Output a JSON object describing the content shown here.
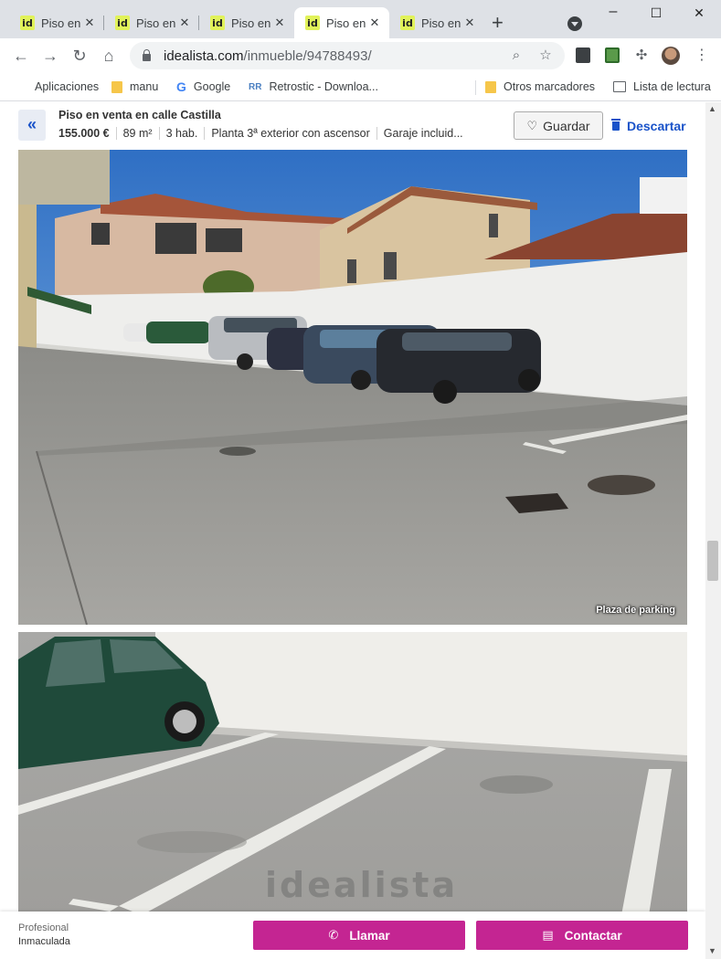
{
  "browser": {
    "tabs": [
      {
        "title": "Piso en venta en calle Castilla",
        "favicon": "id",
        "active": false
      },
      {
        "title": "Piso en venta en calle Castilla",
        "favicon": "id",
        "active": false
      },
      {
        "title": "Piso en venta en calle Castilla",
        "favicon": "id",
        "active": false
      },
      {
        "title": "Piso en venta en calle Castilla",
        "favicon": "id",
        "active": true
      },
      {
        "title": "Piso en venta en calle Castilla",
        "favicon": "id",
        "active": false
      }
    ],
    "url_host": "idealista.com",
    "url_path": "/inmueble/94788493/",
    "bookmarks": [
      {
        "label": "Aplicaciones",
        "icon": "apps-grid-icon"
      },
      {
        "label": "manu",
        "icon": "folder-icon"
      },
      {
        "label": "Google",
        "icon": "google-icon"
      },
      {
        "label": "Retrostic - Downloa...",
        "icon": "retrostic-icon"
      },
      {
        "label": "Otros marcadores",
        "icon": "folder-icon"
      },
      {
        "label": "Lista de lectura",
        "icon": "reading-list-icon"
      }
    ]
  },
  "ad": {
    "title": "Piso en venta en calle Castilla",
    "price": "155.000 €",
    "features": [
      "89 m²",
      "3 hab.",
      "Planta 3ª exterior con ascensor",
      "Garaje incluid..."
    ],
    "save_label": "Guardar",
    "discard_label": "Descartar",
    "colors": {
      "brand_blue": "#1a53c9",
      "cta_magenta": "#c42592"
    }
  },
  "photos": [
    {
      "caption": "Plaza de parking"
    },
    {
      "watermark": "idealista"
    }
  ],
  "contact": {
    "professional_label": "Profesional",
    "agency_name": "Inmaculada",
    "call_label": "Llamar",
    "contact_label": "Contactar"
  }
}
